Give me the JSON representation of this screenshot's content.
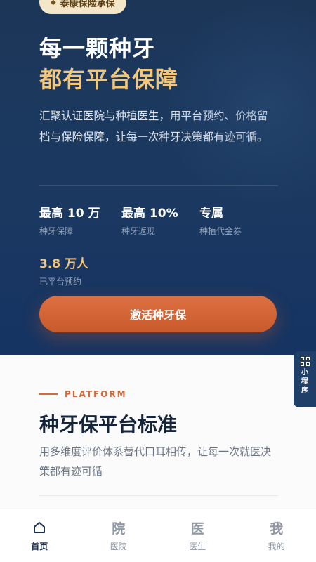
{
  "hero": {
    "badge": "泰康保险承保",
    "title_line1": "每一颗种牙",
    "title_line2": "都有平台保障",
    "description": "汇聚认证医院与种植医生，用平台预约、价格留档与保险保障，让每一次种牙决策都有迹可循。",
    "stats": [
      {
        "value": "最高 10 万",
        "label": "种牙保障"
      },
      {
        "value": "最高 10%",
        "label": "种牙返现"
      },
      {
        "value": "专属",
        "label": "种植代金券"
      },
      {
        "value": "3.8 万人",
        "label": "已平台预约"
      }
    ],
    "cta_label": "激活种牙保"
  },
  "floating_tab": {
    "label": "小程序",
    "icon": "qr-code-icon"
  },
  "platform": {
    "eyebrow": "PLATFORM",
    "title": "种牙保平台标准",
    "description": "用多维度评价体系替代口耳相传，让每一次就医决策都有迹可循"
  },
  "tabbar": {
    "tabs": [
      {
        "label": "首页",
        "icon": "home-icon",
        "glyph": "",
        "active": true
      },
      {
        "label": "医院",
        "icon": "hospital-icon",
        "glyph": "院",
        "active": false
      },
      {
        "label": "医生",
        "icon": "doctor-icon",
        "glyph": "医",
        "active": false
      },
      {
        "label": "我的",
        "icon": "profile-icon",
        "glyph": "我",
        "active": false
      }
    ]
  },
  "colors": {
    "hero_bg": "#1b3960",
    "gold": "#f3c77a",
    "accent": "#d5693a",
    "badge_bg": "#f3e6c9"
  }
}
